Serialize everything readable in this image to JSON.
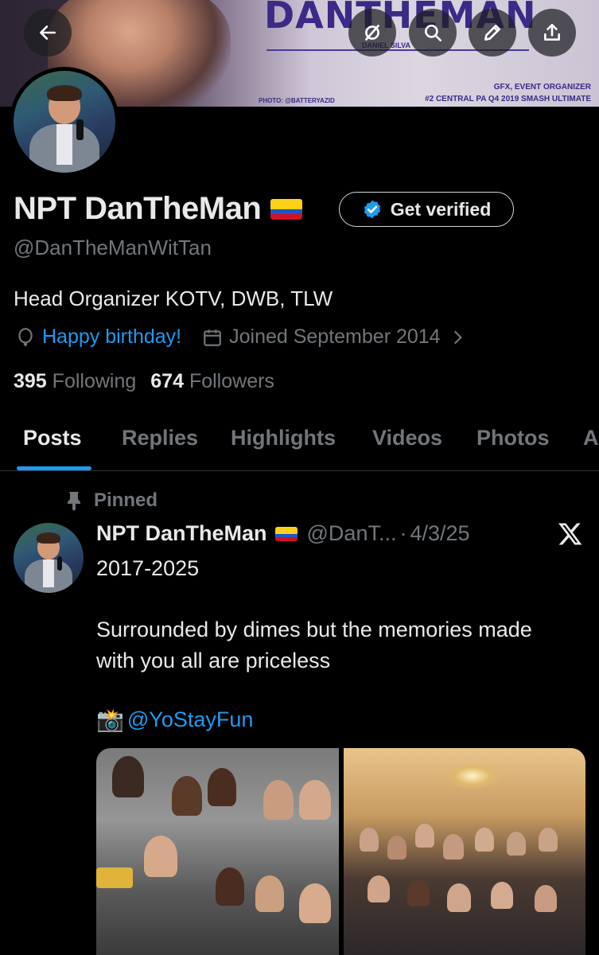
{
  "banner": {
    "title": "DANTHEMAN",
    "subtitle": "DANIEL SILVA",
    "photo_credit": "PHOTO: @BATTERYAZID",
    "line1": "GFX, EVENT ORGANIZER",
    "line2": "#2 CENTRAL PA Q4 2019 SMASH ULTIMATE"
  },
  "profile": {
    "name": "NPT DanTheMan",
    "flag_icon": "colombia-flag",
    "get_verified_label": "Get verified",
    "handle": "@DanTheManWitTan",
    "bio": "Head Organizer KOTV, DWB, TLW",
    "birthday_text": "Happy birthday!",
    "joined_text": "Joined September 2014",
    "following_count": "395",
    "following_label": "Following",
    "followers_count": "674",
    "followers_label": "Followers"
  },
  "tabs": [
    {
      "label": "Posts",
      "active": true
    },
    {
      "label": "Replies"
    },
    {
      "label": "Highlights"
    },
    {
      "label": "Videos"
    },
    {
      "label": "Photos"
    },
    {
      "label": "A"
    }
  ],
  "post": {
    "pinned_label": "Pinned",
    "author_name": "NPT DanTheMan",
    "author_handle": "@DanT...",
    "separator": "·",
    "date": "4/3/25",
    "text": "2017-2025\n\nSurrounded by dimes but the memories made\nwith you all are priceless",
    "camera_emoji": "📸",
    "mention": "@YoStayFun"
  },
  "colors": {
    "accent": "#1d9bf0",
    "text_primary": "#e7e9ea",
    "text_secondary": "#71767b",
    "background": "#000000"
  }
}
